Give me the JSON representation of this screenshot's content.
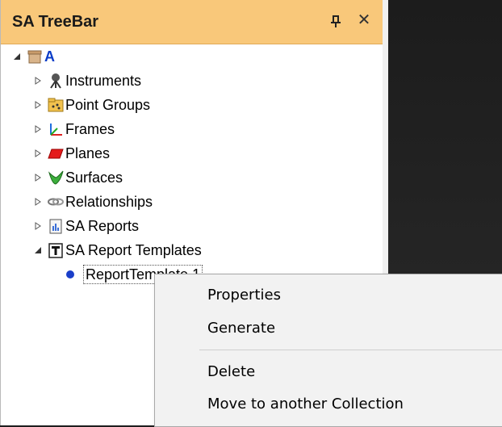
{
  "panel": {
    "title": "SA TreeBar",
    "pin_icon": "pin-icon",
    "close_label": "✕"
  },
  "tree": {
    "root": {
      "label": "A",
      "icon": "root-box-icon",
      "expanded": true
    },
    "items": [
      {
        "label": "Instruments",
        "icon": "instrument-icon",
        "expanded": false
      },
      {
        "label": "Point Groups",
        "icon": "point-groups-icon",
        "expanded": false
      },
      {
        "label": "Frames",
        "icon": "frames-icon",
        "expanded": false
      },
      {
        "label": "Planes",
        "icon": "planes-icon",
        "expanded": false
      },
      {
        "label": "Surfaces",
        "icon": "surfaces-icon",
        "expanded": false
      },
      {
        "label": "Relationships",
        "icon": "relationships-icon",
        "expanded": false
      },
      {
        "label": "SA Reports",
        "icon": "reports-icon",
        "expanded": false
      },
      {
        "label": "SA Report Templates",
        "icon": "report-templates-icon",
        "expanded": true
      }
    ],
    "child": {
      "label": "ReportTemplate 1",
      "icon": "bullet-icon"
    }
  },
  "context_menu": {
    "items": [
      {
        "label": "Properties"
      },
      {
        "label": "Generate"
      },
      {
        "label": "Delete"
      },
      {
        "label": "Move to another Collection"
      }
    ]
  },
  "colors": {
    "titlebar": "#f9c87a",
    "root_text": "#0a3cc8",
    "menu_bg": "#f2f2f2"
  }
}
